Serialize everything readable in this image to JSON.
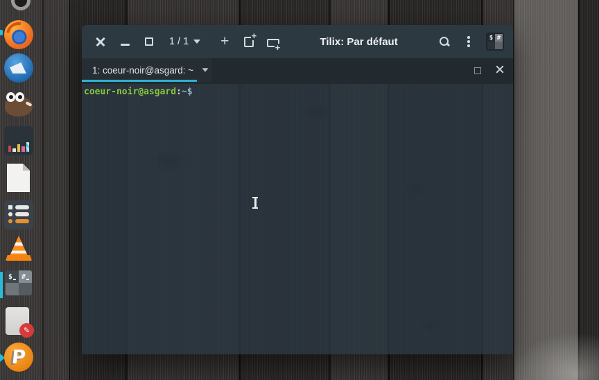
{
  "colors": {
    "accent_cyan": "#2bb3d2",
    "titlebar_bg": "#2c3940",
    "tabbar_bg": "#222a30",
    "terminal_tint": "rgba(42,54,63,0.84)",
    "prompt_green": "#86c540",
    "prompt_blue": "#9cb6cc",
    "dock_indicator": "#29bcd8"
  },
  "dock": {
    "icons": [
      {
        "name": "overflow-app-icon"
      },
      {
        "name": "firefox-icon"
      },
      {
        "name": "thunderbird-icon"
      },
      {
        "name": "gimp-icon"
      },
      {
        "name": "pixel-bars-app-icon"
      },
      {
        "name": "libreoffice-icon"
      },
      {
        "name": "task-list-app-icon"
      },
      {
        "name": "vlc-icon"
      },
      {
        "name": "tilix-icon"
      },
      {
        "name": "notes-app-icon"
      },
      {
        "name": "playonlinux-icon"
      }
    ],
    "tilix_glyphs": {
      "dollar": "$",
      "hash": "#"
    },
    "playonlinux_letter": "P",
    "notes_pencil": "✎"
  },
  "window": {
    "titlebar": {
      "pager": "1 / 1",
      "new_terminal": "+",
      "title": "Tilix: Par défaut",
      "profile_badge": {
        "dollar": "$",
        "hash": "#"
      }
    },
    "tabbar": {
      "active_tab_label": "1: coeur-noir@asgard: ~"
    },
    "terminal": {
      "prompt": {
        "user_host": "coeur-noir@asgard",
        "colon": ":",
        "path": "~",
        "dollar": "$"
      }
    }
  }
}
